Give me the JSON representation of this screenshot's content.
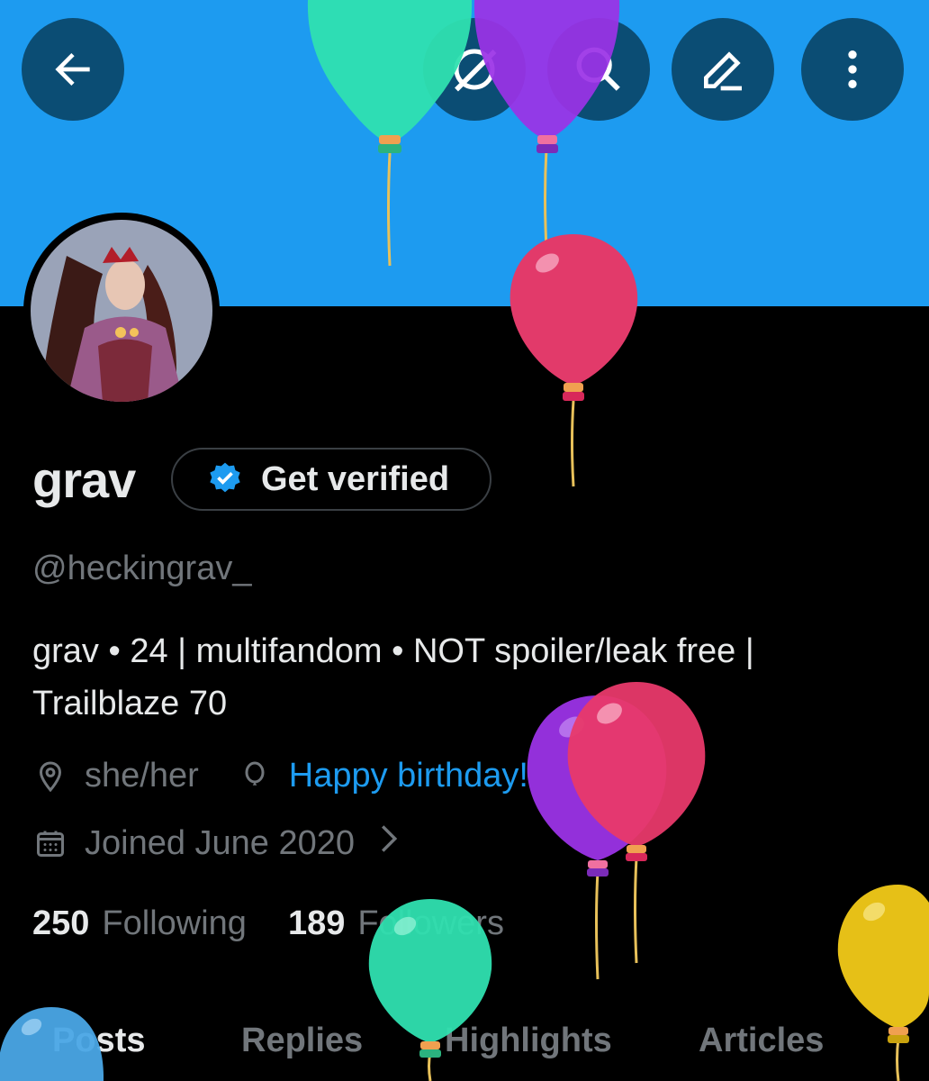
{
  "header": {
    "back_icon": "arrow-left-icon",
    "grok_icon": "grok-icon",
    "search_icon": "search-icon",
    "edit_icon": "edit-icon",
    "more_icon": "more-vertical-icon",
    "banner_color": "#1d9bf0",
    "button_color": "#0b4d74"
  },
  "profile": {
    "display_name": "grav",
    "verify_label": "Get verified",
    "handle": "@heckingrav_",
    "bio_line1": "grav • 24 | multifandom • NOT spoiler/leak free |",
    "bio_line2": "Trailblaze 70",
    "pronouns": "she/her",
    "birthday_text": "Happy birthday!",
    "joined": "Joined June 2020"
  },
  "stats": {
    "following_count": "250",
    "following_label": "Following",
    "followers_count": "189",
    "followers_label": "Followers"
  },
  "tabs": [
    "Posts",
    "Replies",
    "Highlights",
    "Articles"
  ],
  "colors": {
    "accent": "#1d9bf0",
    "text": "#e7e9ea",
    "muted": "#71767b"
  }
}
